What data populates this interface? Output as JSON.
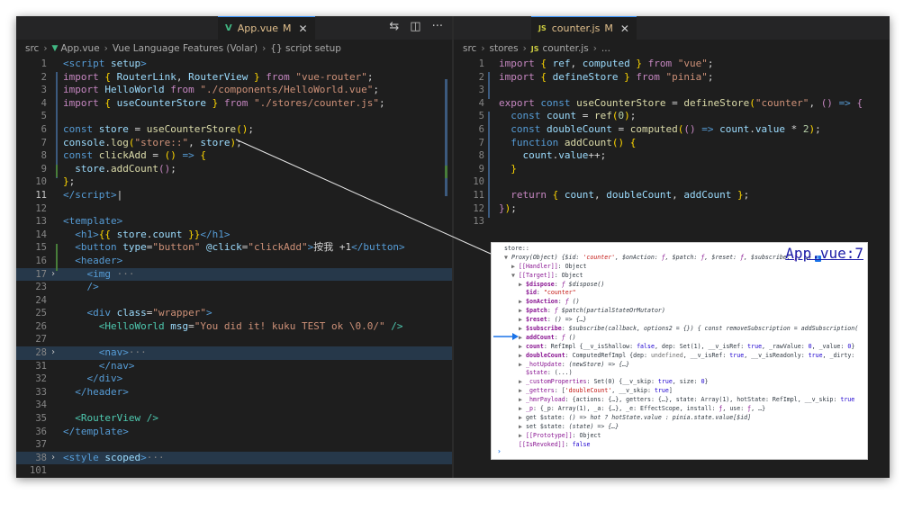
{
  "left": {
    "tab": {
      "icon": "V",
      "label": "App.vue",
      "modified": "M",
      "close": "✕"
    },
    "toolbar": {
      "compare": "⇆",
      "split": "◫",
      "more": "···"
    },
    "breadcrumb": [
      "src",
      "App.vue",
      "Vue Language Features (Volar)",
      "{} script setup"
    ],
    "lines": [
      {
        "n": "1",
        "fold": "",
        "html": "<span class='t-tag'>&lt;script</span> <span class='t-var'>setup</span><span class='t-tag'>&gt;</span>"
      },
      {
        "n": "2",
        "fold": "",
        "html": "<span class='t-ctl'>import</span> <span class='t-br'>{</span> <span class='t-var'>RouterLink</span>, <span class='t-var'>RouterView</span> <span class='t-br'>}</span> <span class='t-ctl'>from</span> <span class='t-str'>\"vue-router\"</span>;"
      },
      {
        "n": "3",
        "fold": "",
        "html": "<span class='t-ctl'>import</span> <span class='t-var'>HelloWorld</span> <span class='t-ctl'>from</span> <span class='t-str'>\"./components/HelloWorld.vue\"</span>;"
      },
      {
        "n": "4",
        "fold": "",
        "html": "<span class='t-ctl'>import</span> <span class='t-br'>{</span> <span class='t-var'>useCounterStore</span> <span class='t-br'>}</span> <span class='t-ctl'>from</span> <span class='t-str'>\"./stores/counter.js\"</span>;"
      },
      {
        "n": "5",
        "fold": "",
        "html": ""
      },
      {
        "n": "6",
        "fold": "",
        "html": "<span class='t-kw'>const</span> <span class='t-var'>store</span> = <span class='t-fn'>useCounterStore</span><span class='t-br'>()</span>;"
      },
      {
        "n": "7",
        "fold": "",
        "html": "<span class='t-var'>console</span>.<span class='t-fn'>log</span><span class='t-br'>(</span><span class='t-str'>\"store::\"</span>, <span class='t-var'>store</span><span class='t-br'>)</span>;"
      },
      {
        "n": "8",
        "fold": "",
        "html": "<span class='t-kw'>const</span> <span class='t-fn'>clickAdd</span> = <span class='t-br'>()</span> <span class='t-kw'>=&gt;</span> <span class='t-br'>{</span>"
      },
      {
        "n": "9",
        "fold": "",
        "html": "  <span class='t-var'>store</span>.<span class='t-fn'>addCount</span><span class='t-ctl'>()</span>;"
      },
      {
        "n": "10",
        "fold": "",
        "html": "<span class='t-br'>}</span>;"
      },
      {
        "n": "11",
        "fold": "",
        "html": "<span class='t-tag'>&lt;/script&gt;</span>|",
        "current": true
      },
      {
        "n": "12",
        "fold": "",
        "html": ""
      },
      {
        "n": "13",
        "fold": "",
        "html": "<span class='t-tag'>&lt;template&gt;</span>"
      },
      {
        "n": "14",
        "fold": "",
        "html": "  <span class='t-tag'>&lt;h1&gt;</span><span class='t-br'>{{</span> <span class='t-var'>store</span>.<span class='t-var'>count</span> <span class='t-br'>}}</span><span class='t-tag'>&lt;/h1&gt;</span>"
      },
      {
        "n": "15",
        "fold": "",
        "html": "  <span class='t-tag'>&lt;button</span> <span class='t-var'>type</span>=<span class='t-str'>\"button\"</span> <span class='t-var'>@click</span>=<span class='t-str'>\"clickAdd\"</span><span class='t-tag'>&gt;</span>按我 +1<span class='t-tag'>&lt;/button&gt;</span>"
      },
      {
        "n": "16",
        "fold": "",
        "html": "  <span class='t-tag'>&lt;header&gt;</span>"
      },
      {
        "n": "17",
        "fold": "›",
        "html": "    <span class='t-tag'>&lt;img</span><span class='t-gr'> ···</span>",
        "hl": true
      },
      {
        "n": "23",
        "fold": "",
        "html": "    <span class='t-tag'>/&gt;</span>"
      },
      {
        "n": "24",
        "fold": "",
        "html": ""
      },
      {
        "n": "25",
        "fold": "",
        "html": "    <span class='t-tag'>&lt;div</span> <span class='t-var'>class</span>=<span class='t-str'>\"wrapper\"</span><span class='t-tag'>&gt;</span>"
      },
      {
        "n": "26",
        "fold": "",
        "html": "      <span class='t-cmp'>&lt;HelloWorld</span> <span class='t-var'>msg</span>=<span class='t-str'>\"You did it! kuku TEST ok \\0.0/\"</span> <span class='t-cmp'>/&gt;</span>"
      },
      {
        "n": "27",
        "fold": "",
        "html": ""
      },
      {
        "n": "28",
        "fold": "›",
        "html": "      <span class='t-tag'>&lt;nav&gt;</span><span class='t-gr'>···</span>",
        "hl": true
      },
      {
        "n": "31",
        "fold": "",
        "html": "      <span class='t-tag'>&lt;/nav&gt;</span>"
      },
      {
        "n": "32",
        "fold": "",
        "html": "    <span class='t-tag'>&lt;/div&gt;</span>"
      },
      {
        "n": "33",
        "fold": "",
        "html": "  <span class='t-tag'>&lt;/header&gt;</span>"
      },
      {
        "n": "34",
        "fold": "",
        "html": ""
      },
      {
        "n": "35",
        "fold": "",
        "html": "  <span class='t-cmp'>&lt;RouterView</span> <span class='t-cmp'>/&gt;</span>"
      },
      {
        "n": "36",
        "fold": "",
        "html": "<span class='t-tag'>&lt;/template&gt;</span>"
      },
      {
        "n": "37",
        "fold": "",
        "html": ""
      },
      {
        "n": "38",
        "fold": "›",
        "html": "<span class='t-tag'>&lt;style</span> <span class='t-var'>scoped</span><span class='t-tag'>&gt;</span><span class='t-gr'>···</span>",
        "hl": true
      },
      {
        "n": "101",
        "fold": "",
        "html": ""
      }
    ]
  },
  "right": {
    "tab": {
      "icon": "JS",
      "label": "counter.js",
      "modified": "M",
      "close": "✕"
    },
    "breadcrumb": [
      "src",
      "stores",
      "counter.js",
      "..."
    ],
    "lines": [
      {
        "n": "1",
        "html": "<span class='t-ctl'>import</span> <span class='t-br'>{</span> <span class='t-var'>ref</span>, <span class='t-var'>computed</span> <span class='t-br'>}</span> <span class='t-ctl'>from</span> <span class='t-str'>\"vue\"</span>;"
      },
      {
        "n": "2",
        "html": "<span class='t-ctl'>import</span> <span class='t-br'>{</span> <span class='t-var'>defineStore</span> <span class='t-br'>}</span> <span class='t-ctl'>from</span> <span class='t-str'>\"pinia\"</span>;"
      },
      {
        "n": "3",
        "html": ""
      },
      {
        "n": "4",
        "html": "<span class='t-ctl'>export</span> <span class='t-kw'>const</span> <span class='t-fn'>useCounterStore</span> = <span class='t-fn'>defineStore</span><span class='t-br'>(</span><span class='t-str'>\"counter\"</span>, <span class='t-ctl'>()</span> <span class='t-kw'>=&gt;</span> <span class='t-ctl'>{</span>"
      },
      {
        "n": "5",
        "html": "  <span class='t-kw'>const</span> <span class='t-var'>count</span> = <span class='t-fn'>ref</span><span class='t-br'>(</span><span class='t-num'>0</span><span class='t-br'>)</span>;"
      },
      {
        "n": "6",
        "html": "  <span class='t-kw'>const</span> <span class='t-var'>doubleCount</span> = <span class='t-fn'>computed</span><span class='t-br'>(</span><span class='t-ctl'>()</span> <span class='t-kw'>=&gt;</span> <span class='t-var'>count</span>.<span class='t-var'>value</span> * <span class='t-num'>2</span><span class='t-br'>)</span>;"
      },
      {
        "n": "7",
        "html": "  <span class='t-kw'>function</span> <span class='t-fn'>addCount</span><span class='t-br'>()</span> <span class='t-br'>{</span>"
      },
      {
        "n": "8",
        "html": "    <span class='t-var'>count</span>.<span class='t-var'>value</span>++;"
      },
      {
        "n": "9",
        "html": "  <span class='t-br'>}</span>"
      },
      {
        "n": "10",
        "html": ""
      },
      {
        "n": "11",
        "html": "  <span class='t-ctl'>return</span> <span class='t-br'>{</span> <span class='t-var'>count</span>, <span class='t-var'>doubleCount</span>, <span class='t-var'>addCount</span> <span class='t-br'>}</span>;"
      },
      {
        "n": "12",
        "html": "<span class='t-ctl'>}</span><span class='t-br'>)</span>;"
      },
      {
        "n": "13",
        "html": ""
      }
    ]
  },
  "devtools": {
    "link": "App.vue:7",
    "prompt": "›",
    "info": "i",
    "lines": [
      {
        "i": 0,
        "tri": "",
        "html": "store::"
      },
      {
        "i": 1,
        "tri": "▼",
        "html": "<span class='d-it'>Proxy(Object) {$id: <span class='d-str'>'counter'</span>, $onAction: <span class='d-keyp'>ƒ</span>, $patch: <span class='d-keyp'>ƒ</span>, $reset: <span class='d-keyp'>ƒ</span>, $subscribe: <span class='d-keyp'>ƒ</span>, …}</span>"
      },
      {
        "i": 2,
        "tri": "▶",
        "html": "<span class='d-keyp'>[[Handler]]</span>: Object"
      },
      {
        "i": 2,
        "tri": "▼",
        "html": "<span class='d-keyp'>[[Target]]</span>: Object"
      },
      {
        "i": 3,
        "tri": "▶",
        "html": "<span class='d-key'>$dispose</span>: <span class='d-it'><span class='d-keyp'>ƒ</span> $dispose()</span>"
      },
      {
        "i": 3,
        "tri": "",
        "html": "<span class='d-key'>$id</span>: <span class='d-str'>\"counter\"</span>"
      },
      {
        "i": 3,
        "tri": "▶",
        "html": "<span class='d-key'>$onAction</span>: <span class='d-it'><span class='d-keyp'>ƒ</span> ()</span>"
      },
      {
        "i": 3,
        "tri": "▶",
        "html": "<span class='d-key'>$patch</span>: <span class='d-it'><span class='d-keyp'>ƒ</span> $patch(partialStateOrMutator)</span>"
      },
      {
        "i": 3,
        "tri": "▶",
        "html": "<span class='d-key'>$reset</span>: <span class='d-it'>() =&gt; {…}</span>"
      },
      {
        "i": 3,
        "tri": "▶",
        "html": "<span class='d-key'>$subscribe</span>: <span class='d-it'>$subscribe(callback, options2 = {}) { const removeSubscription = addSubscription(</span>"
      },
      {
        "i": 3,
        "tri": "▶",
        "html": "<span class='d-key'>addCount</span>: <span class='d-it'><span class='d-keyp'>ƒ</span> ()</span>"
      },
      {
        "i": 3,
        "tri": "▶",
        "html": "<span class='d-key'>count</span>: RefImpl {__v_isShallow: <span class='d-num'>false</span>, dep: Set(1), __v_isRef: <span class='d-num'>true</span>, _rawValue: <span class='d-num'>0</span>, _value: <span class='d-num'>0</span>}"
      },
      {
        "i": 3,
        "tri": "▶",
        "html": "<span class='d-key'>doubleCount</span>: ComputedRefImpl {dep: <span class='d-gray'>undefined</span>, __v_isRef: <span class='d-num'>true</span>, __v_isReadonly: <span class='d-num'>true</span>, _dirty:"
      },
      {
        "i": 3,
        "tri": "▶",
        "html": "<span class='d-keyp'>_hotUpdate</span>: <span class='d-it'>(newStore) =&gt; {…}</span>"
      },
      {
        "i": 3,
        "tri": "",
        "html": "<span class='d-keyp'>$state</span>: (...)"
      },
      {
        "i": 3,
        "tri": "▶",
        "html": "<span class='d-keyp'>_customProperties</span>: Set(0) {__v_skip: <span class='d-num'>true</span>, size: <span class='d-num'>0</span>}"
      },
      {
        "i": 3,
        "tri": "▶",
        "html": "<span class='d-keyp'>_getters</span>: [<span class='d-str'>'doubleCount'</span>, __v_skip: <span class='d-num'>true</span>]"
      },
      {
        "i": 3,
        "tri": "▶",
        "html": "<span class='d-keyp'>_hmrPayload</span>: {actions: {…}, getters: {…}, state: Array(1), hotState: RefImpl, __v_skip: <span class='d-num'>true</span>"
      },
      {
        "i": 3,
        "tri": "▶",
        "html": "<span class='d-keyp'>_p</span>: {_p: Array(1), _a: {…}, _e: EffectScope, install: <span class='d-keyp'>ƒ</span>, use: <span class='d-keyp'>ƒ</span>, …}"
      },
      {
        "i": 3,
        "tri": "▶",
        "html": "get $state: <span class='d-it'>() =&gt; hot ? hotState.value : pinia.state.value[$id]</span>"
      },
      {
        "i": 3,
        "tri": "▶",
        "html": "set $state: <span class='d-it'>(state) =&gt; {…}</span>"
      },
      {
        "i": 3,
        "tri": "▶",
        "html": "<span class='d-keyp'>[[Prototype]]</span>: Object"
      },
      {
        "i": 2,
        "tri": "",
        "html": "<span class='d-keyp'>[[IsRevoked]]</span>: <span class='d-num'>false</span>"
      }
    ]
  },
  "colors": {
    "editor_bg": "#1e1e1e",
    "tab_active_border": "#3794ff",
    "modified": "#e2c08d",
    "arrow": "#1a73e8"
  }
}
